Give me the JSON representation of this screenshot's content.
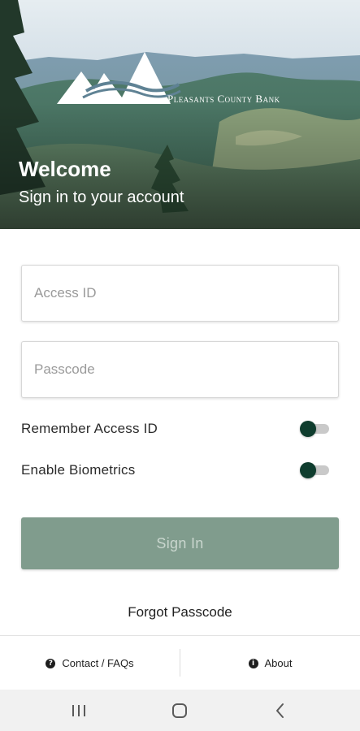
{
  "brand": {
    "name": "Pleasants County Bank"
  },
  "hero": {
    "title": "Welcome",
    "subtitle": "Sign in to your account"
  },
  "form": {
    "access_id_placeholder": "Access ID",
    "access_id_value": "",
    "passcode_placeholder": "Passcode",
    "passcode_value": "",
    "remember_label": "Remember Access ID",
    "remember_on": false,
    "biometrics_label": "Enable Biometrics",
    "biometrics_on": false,
    "signin_label": "Sign In",
    "forgot_label": "Forgot Passcode"
  },
  "tabbar": {
    "contact_label": "Contact / FAQs",
    "contact_icon": "question-circle-icon",
    "about_label": "About",
    "about_icon": "info-circle-icon"
  },
  "system_nav": {
    "recents_icon": "recents-icon",
    "home_icon": "home-icon",
    "back_icon": "back-icon"
  },
  "colors": {
    "accent": "#0f3d2e",
    "button_disabled": "#809c8d",
    "button_text_disabled": "#c9d6ce"
  }
}
